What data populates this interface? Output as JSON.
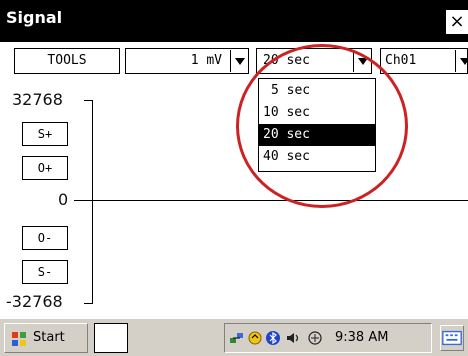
{
  "window": {
    "title": "Signal",
    "close_label": "×"
  },
  "toolbar": {
    "tools_label": "TOOLS",
    "range_value": "1 mV",
    "time_value": "20 sec",
    "channel_value": "Ch01"
  },
  "time_dropdown": {
    "options": [
      "5 sec",
      "10 sec",
      "20 sec",
      "40 sec"
    ],
    "selected": "20 sec"
  },
  "plot": {
    "y_max": "32768",
    "y_zero": "0",
    "y_min": "-32768",
    "buttons": {
      "s_plus": "S+",
      "o_plus": "O+",
      "o_minus": "O-",
      "s_minus": "S-"
    }
  },
  "taskbar": {
    "start_label": "Start",
    "clock": "9:38 AM"
  },
  "icons": [
    "close-icon",
    "dropdown-arrow-icon",
    "windows-logo-icon",
    "network-icon",
    "sync-icon",
    "bluetooth-icon",
    "volume-icon",
    "infrared-icon",
    "keyboard-icon"
  ],
  "colors": {
    "titlebar": "#000000",
    "highlight_circle": "#cc2222",
    "taskbar": "#d4d0c8",
    "selected_option": "#000000"
  }
}
